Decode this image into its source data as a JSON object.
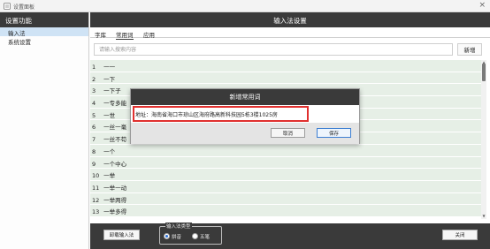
{
  "window": {
    "title": "设置面板",
    "close_glyph": "×"
  },
  "sidebar": {
    "header": "设置功能",
    "items": [
      {
        "label": "输入法",
        "active": true
      },
      {
        "label": "系统设置",
        "active": false
      }
    ]
  },
  "main": {
    "header": "输入法设置",
    "tabs": [
      {
        "label": "字库",
        "active": false
      },
      {
        "label": "常用词",
        "active": true
      },
      {
        "label": "应用",
        "active": false
      }
    ],
    "search": {
      "placeholder": "请输入搜索内容",
      "value": ""
    },
    "add_label": "新增",
    "rows": [
      {
        "num": "1",
        "text": "一一"
      },
      {
        "num": "2",
        "text": "一下"
      },
      {
        "num": "3",
        "text": "一下子"
      },
      {
        "num": "4",
        "text": "一专多能"
      },
      {
        "num": "5",
        "text": "一世"
      },
      {
        "num": "6",
        "text": "一丝一毫"
      },
      {
        "num": "7",
        "text": "一丝不苟"
      },
      {
        "num": "8",
        "text": "一个"
      },
      {
        "num": "9",
        "text": "一个中心"
      },
      {
        "num": "10",
        "text": "一举"
      },
      {
        "num": "11",
        "text": "一举一动"
      },
      {
        "num": "12",
        "text": "一举两得"
      },
      {
        "num": "13",
        "text": "一举多得"
      }
    ]
  },
  "footer": {
    "uninstall_label": "卸载输入法",
    "ime_type_label": "输入法类型",
    "options": [
      {
        "label": "拼音",
        "selected": true
      },
      {
        "label": "五笔",
        "selected": false
      }
    ],
    "close_label": "关闭"
  },
  "dialog": {
    "title": "新增常用词",
    "input_value": "地址：海南省海口市琼山区海府路高新科技园5栋3楼1025房",
    "cancel_label": "取消",
    "save_label": "保存",
    "highlight_color": "#e0302f"
  },
  "icons": {
    "app": "settings-panel-icon",
    "close": "close-icon",
    "scroll_up": "scroll-up-arrow-icon",
    "scroll_down": "scroll-down-arrow-icon"
  },
  "colors": {
    "header_bg": "#3a3a3a",
    "row_bg": "#e6efe6",
    "sidebar_active": "#cfe3f5",
    "radio_selected": "#2a6fd6"
  }
}
